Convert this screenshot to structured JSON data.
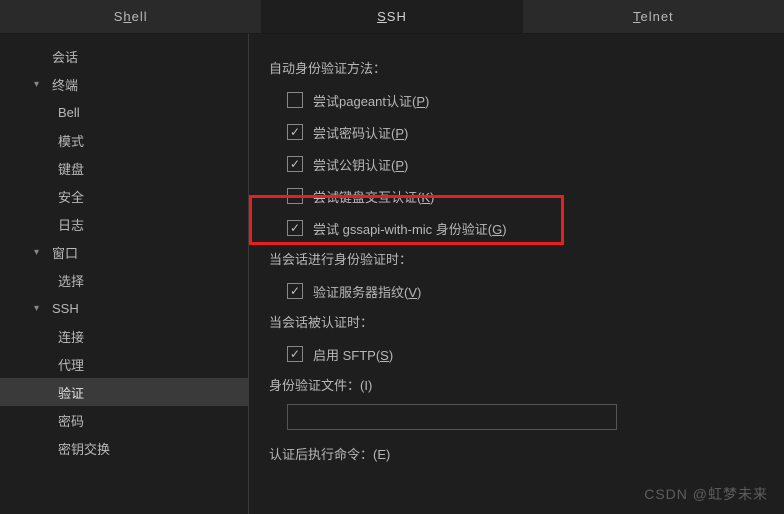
{
  "tabs": [
    {
      "label_pre": "S",
      "label_und": "h",
      "label_post": "ell",
      "active": false
    },
    {
      "label_pre": "",
      "label_und": "S",
      "label_post": "SH",
      "active": true
    },
    {
      "label_pre": "",
      "label_und": "T",
      "label_post": "elnet",
      "active": false
    }
  ],
  "sidebar": [
    {
      "label": "会话",
      "level": 1,
      "expandable": false
    },
    {
      "label": "终端",
      "level": 1,
      "expandable": true,
      "expanded": true
    },
    {
      "label": "Bell",
      "level": 2
    },
    {
      "label": "模式",
      "level": 2
    },
    {
      "label": "键盘",
      "level": 2
    },
    {
      "label": "安全",
      "level": 2
    },
    {
      "label": "日志",
      "level": 2
    },
    {
      "label": "窗口",
      "level": 1,
      "expandable": true,
      "expanded": true
    },
    {
      "label": "选择",
      "level": 2
    },
    {
      "label": "SSH",
      "level": 1,
      "expandable": true,
      "expanded": true
    },
    {
      "label": "连接",
      "level": 2
    },
    {
      "label": "代理",
      "level": 2
    },
    {
      "label": "验证",
      "level": 2,
      "selected": true
    },
    {
      "label": "密码",
      "level": 2
    },
    {
      "label": "密钥交换",
      "level": 2
    }
  ],
  "panel": {
    "auth_methods_label": "自动身份验证方法：",
    "checks": [
      {
        "pre": "尝试pageant认证(",
        "und": "P",
        "post": ")",
        "checked": false
      },
      {
        "pre": "尝试密码认证(",
        "und": "P",
        "post": ")",
        "checked": true
      },
      {
        "pre": "尝试公钥认证(",
        "und": "P",
        "post": ")",
        "checked": true
      },
      {
        "pre": "尝试键盘交互认证(",
        "und": "K",
        "post": ")",
        "checked": false,
        "highlight": true
      },
      {
        "pre": "尝试 gssapi-with-mic 身份验证(",
        "und": "G",
        "post": ")",
        "checked": true
      }
    ],
    "session_auth_label": "当会话进行身份验证时：",
    "verify_fingerprint": {
      "pre": "验证服务器指纹(",
      "und": "V",
      "post": ")",
      "checked": true
    },
    "session_authd_label": "当会话被认证时：",
    "enable_sftp": {
      "pre": "启用 SFTP(",
      "und": "S",
      "post": ")",
      "checked": true
    },
    "id_file_label_pre": "身份验证文件：(",
    "id_file_label_und": "I",
    "id_file_label_post": ")",
    "post_cmd_label_pre": "认证后执行命令：(",
    "post_cmd_label_und": "E",
    "post_cmd_label_post": ")"
  },
  "watermark": "CSDN @虹梦未来"
}
